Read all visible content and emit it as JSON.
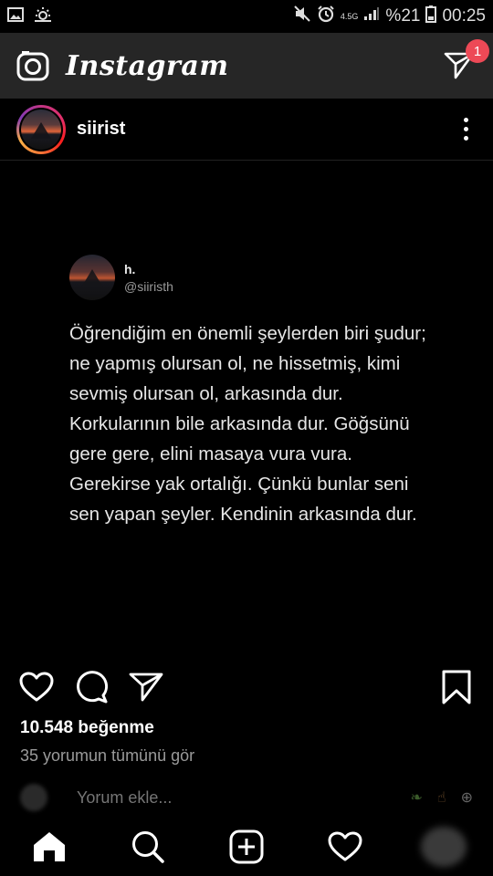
{
  "status_bar": {
    "network": "4.5G",
    "battery": "%21",
    "time": "00:25"
  },
  "header": {
    "brand": "Instagram",
    "dm_badge": "1"
  },
  "post": {
    "username": "siirist",
    "tweet": {
      "name": "h.",
      "handle": "@siiristh",
      "text": "Öğrendiğim en önemli şeylerden biri şudur; ne yapmış olursan ol, ne hissetmiş, kimi sevmiş olursan ol, arkasında dur. Korkularının bile arkasında dur. Göğsünü gere gere, elini masaya vura vura. Gerekirse yak ortalığı. Çünkü bunlar seni sen yapan şeyler. Kendinin arkasında dur."
    },
    "likes": "10.548 beğenme",
    "comments_link": "35 yorumun tümünü gör",
    "comment_placeholder": "Yorum ekle..."
  },
  "colors": {
    "background": "#000000",
    "header_bg": "#262626",
    "badge": "#ed4956",
    "muted_text": "#9a9a9a"
  },
  "icons": {
    "camera": "camera-icon",
    "direct": "direct-message-icon",
    "more": "more-options-icon",
    "like": "heart-icon",
    "comment": "comment-icon",
    "share": "send-icon",
    "save": "bookmark-icon",
    "home": "home-icon",
    "search": "search-icon",
    "add": "add-post-icon",
    "activity": "heart-icon"
  }
}
